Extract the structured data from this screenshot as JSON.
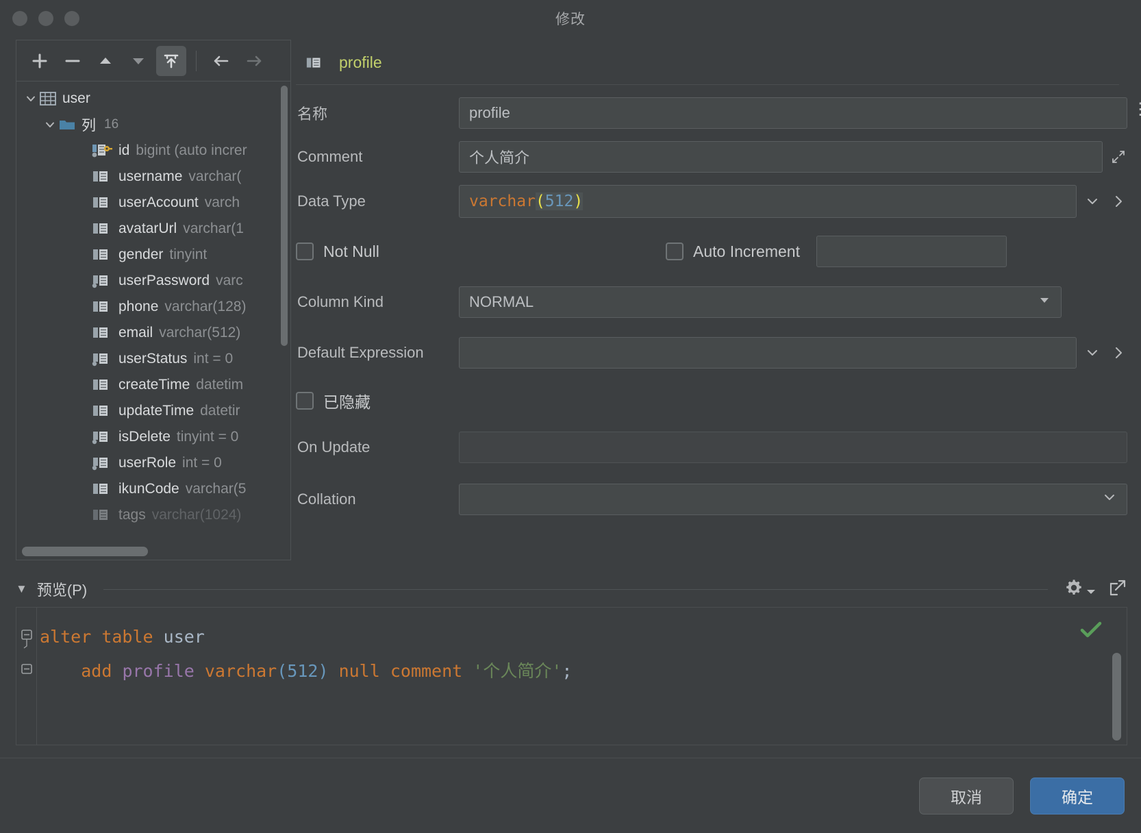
{
  "window": {
    "title": "修改"
  },
  "toolbar": {
    "buttons": [
      {
        "name": "add-button",
        "glyph": "plus"
      },
      {
        "name": "remove-button",
        "glyph": "minus"
      },
      {
        "name": "move-up-button",
        "glyph": "triangle-up"
      },
      {
        "name": "move-down-button",
        "glyph": "triangle-down"
      },
      {
        "name": "export-button",
        "glyph": "export"
      },
      {
        "name": "back-button",
        "glyph": "arrow-left"
      },
      {
        "name": "forward-button",
        "glyph": "arrow-right"
      }
    ]
  },
  "tree": {
    "root": {
      "label": "user",
      "icon": "table-icon",
      "expanded": true
    },
    "group": {
      "label": "列",
      "count": "16",
      "icon": "folder-icon",
      "expanded": true
    },
    "columns": [
      {
        "name": "id",
        "type": "bigint (auto increr",
        "icon": "key-column-icon"
      },
      {
        "name": "username",
        "type": "varchar(",
        "icon": "column-icon"
      },
      {
        "name": "userAccount",
        "type": "varch",
        "icon": "column-icon"
      },
      {
        "name": "avatarUrl",
        "type": "varchar(1",
        "icon": "column-icon"
      },
      {
        "name": "gender",
        "type": "tinyint",
        "icon": "column-icon"
      },
      {
        "name": "userPassword",
        "type": "varc",
        "icon": "column-not-null-icon"
      },
      {
        "name": "phone",
        "type": "varchar(128)",
        "icon": "column-icon"
      },
      {
        "name": "email",
        "type": "varchar(512)",
        "icon": "column-icon"
      },
      {
        "name": "userStatus",
        "type": "int = 0",
        "icon": "column-not-null-icon"
      },
      {
        "name": "createTime",
        "type": "datetim",
        "icon": "column-icon"
      },
      {
        "name": "updateTime",
        "type": "datetir",
        "icon": "column-icon"
      },
      {
        "name": "isDelete",
        "type": "tinyint = 0",
        "icon": "column-not-null-icon"
      },
      {
        "name": "userRole",
        "type": "int = 0",
        "icon": "column-not-null-icon"
      },
      {
        "name": "ikunCode",
        "type": "varchar(5",
        "icon": "column-icon"
      },
      {
        "name": "tags",
        "type": "varchar(1024)",
        "icon": "column-icon"
      }
    ]
  },
  "form": {
    "header_name": "profile",
    "name": {
      "label": "名称",
      "value": "profile"
    },
    "comment": {
      "label": "Comment",
      "value": "个人简介"
    },
    "data_type": {
      "label": "Data Type",
      "type_word": "varchar",
      "open_paren": "(",
      "length": "512",
      "close_paren": ")"
    },
    "not_null": {
      "label": "Not Null",
      "checked": false
    },
    "auto_increment": {
      "label": "Auto Increment",
      "checked": false,
      "value": ""
    },
    "column_kind": {
      "label": "Column Kind",
      "value": "NORMAL"
    },
    "default_expression": {
      "label": "Default Expression",
      "value": ""
    },
    "hidden": {
      "label": "已隐藏",
      "checked": false
    },
    "on_update": {
      "label": "On Update",
      "value": "",
      "disabled": true
    },
    "collation": {
      "label": "Collation",
      "value": ""
    }
  },
  "preview": {
    "title": "预览(P)",
    "settings_icon": "gear-icon",
    "expand_icon": "expand-icon",
    "status_icon": "check-icon",
    "sql": {
      "line1": {
        "kw1": "alter",
        "kw2": "table",
        "id": "user"
      },
      "line2": {
        "kw_add": "add",
        "col": "profile",
        "type": "varchar",
        "open": "(",
        "len": "512",
        "close": ")",
        "kw_null": "null",
        "kw_comment": "comment",
        "str": "'个人简介'",
        "semi": ";"
      }
    }
  },
  "footer": {
    "cancel": "取消",
    "ok": "确定"
  },
  "colors": {
    "accent": "#3b6ea5",
    "header_name": "#c2d06b",
    "type_keyword": "#cc7832",
    "number": "#6897bb",
    "string": "#6a8759",
    "success": "#5a9e5a"
  }
}
